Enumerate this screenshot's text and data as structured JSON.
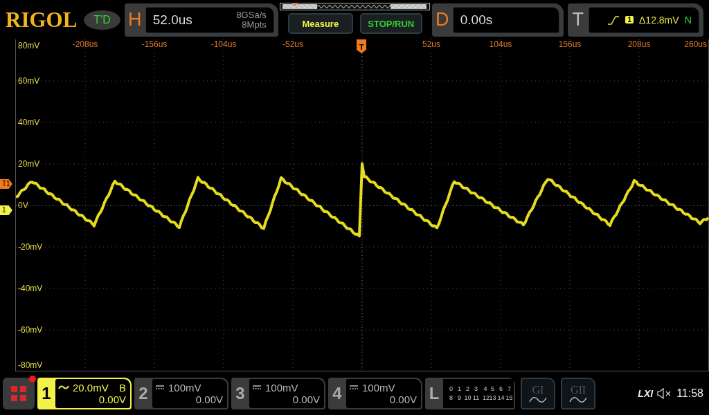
{
  "logo": "RIGOL",
  "mode_badge": "T'D",
  "horizontal": {
    "label": "H",
    "timebase": "52.0us",
    "sample_rate": "8GSa/s",
    "memory_depth": "8Mpts"
  },
  "buttons": [
    {
      "label": "Measure",
      "kind": "measure"
    },
    {
      "label": "STOP/RUN",
      "kind": "run"
    }
  ],
  "delay": {
    "label": "D",
    "value": "0.00s"
  },
  "trigger": {
    "label": "T",
    "source": "1",
    "level": "Δ12.8mV",
    "sweep": "N"
  },
  "plot": {
    "time_labels": [
      "-208us",
      "-156us",
      "-104us",
      "-52us",
      "52us",
      "104us",
      "156us",
      "208us",
      "260us"
    ],
    "voltage_labels": [
      "80mV",
      "60mV",
      "40mV",
      "20mV",
      "0V",
      "-20mV",
      "-40mV",
      "-60mV",
      "-80mV"
    ],
    "trigger_marker": "T",
    "markers": [
      {
        "label": "T1",
        "kind": "trigger"
      },
      {
        "label": "1",
        "kind": "channel"
      }
    ]
  },
  "channels": [
    {
      "number": "1",
      "kind": "ac",
      "scale": "20.0mV",
      "bandwidth": "B",
      "offset": "0.00V",
      "selected": true
    },
    {
      "number": "2",
      "kind": "dc",
      "scale": "100mV",
      "offset": "0.00V",
      "selected": false
    },
    {
      "number": "3",
      "kind": "dc",
      "scale": "100mV",
      "offset": "0.00V",
      "selected": false
    },
    {
      "number": "4",
      "kind": "dc",
      "scale": "100mV",
      "offset": "0.00V",
      "selected": false
    }
  ],
  "logic": {
    "label": "L",
    "rows": [
      [
        "0",
        "1",
        "2",
        "3",
        "4",
        "5",
        "6",
        "7"
      ],
      [
        "8",
        "9",
        "10",
        "11",
        "12",
        "13",
        "14",
        "15"
      ]
    ]
  },
  "generators": [
    {
      "label": "GI"
    },
    {
      "label": "GII"
    }
  ],
  "status": {
    "lxi": "LXI",
    "muted": true,
    "time": "11:58"
  }
}
